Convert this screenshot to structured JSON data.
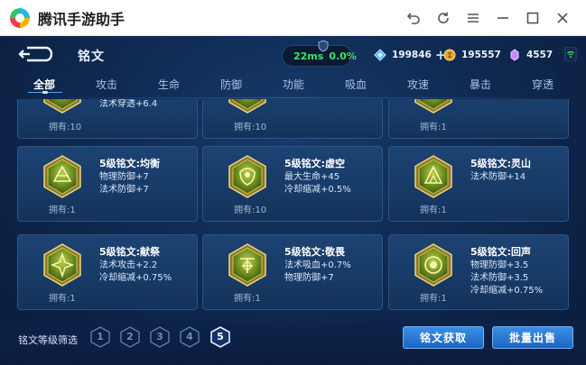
{
  "window": {
    "title": "腾讯手游助手",
    "controls": [
      "back-icon",
      "refresh-icon",
      "menu-icon",
      "minimize-icon",
      "maximize-icon",
      "close-icon"
    ]
  },
  "header": {
    "title": "铭文",
    "ping_ms": "22ms",
    "ping_loss": "0.0%",
    "currencies": [
      {
        "icon": "diamond-coupon-icon",
        "value": "199846",
        "has_plus": true
      },
      {
        "icon": "gold-coin-icon",
        "value": "195557",
        "has_plus": false
      },
      {
        "icon": "crystal-gem-icon",
        "value": "4557",
        "has_plus": false
      }
    ]
  },
  "tabs": [
    {
      "label": "全部",
      "active": true
    },
    {
      "label": "攻击",
      "active": false
    },
    {
      "label": "生命",
      "active": false
    },
    {
      "label": "防御",
      "active": false
    },
    {
      "label": "功能",
      "active": false
    },
    {
      "label": "吸血",
      "active": false
    },
    {
      "label": "攻速",
      "active": false
    },
    {
      "label": "暴击",
      "active": false
    },
    {
      "label": "穿透",
      "active": false
    }
  ],
  "cards": [
    {
      "name": "",
      "attrs": [
        "法术穿透+6.4"
      ],
      "own": "拥有:10",
      "color": "#6c8f22",
      "row": 0,
      "col": 0
    },
    {
      "name": "",
      "attrs": [],
      "own": "拥有:10",
      "color": "#6c8f22",
      "row": 0,
      "col": 1
    },
    {
      "name": "",
      "attrs": [],
      "own": "拥有:1",
      "color": "#6c8f22",
      "row": 0,
      "col": 2
    },
    {
      "name": "5级铭文:均衡",
      "attrs": [
        "物理防御+7",
        "法术防御+7"
      ],
      "own": "拥有:1",
      "color": "#7a9a1f",
      "row": 1,
      "col": 0
    },
    {
      "name": "5级铭文:虚空",
      "attrs": [
        "最大生命+45",
        "冷却缩减+0.5%"
      ],
      "own": "拥有:10",
      "color": "#7a9a1f",
      "row": 1,
      "col": 1
    },
    {
      "name": "5级铭文:灵山",
      "attrs": [
        "法术防御+14"
      ],
      "own": "拥有:1",
      "color": "#7a9a1f",
      "row": 1,
      "col": 2
    },
    {
      "name": "5级铭文:献祭",
      "attrs": [
        "法术攻击+2.2",
        "冷却缩减+0.75%"
      ],
      "own": "拥有:1",
      "color": "#7a9a1f",
      "row": 2,
      "col": 0
    },
    {
      "name": "5级铭文:敬畏",
      "attrs": [
        "法术吸血+0.7%",
        "物理防御+7"
      ],
      "own": "拥有:1",
      "color": "#7a9a1f",
      "row": 2,
      "col": 1
    },
    {
      "name": "5级铭文:回声",
      "attrs": [
        "物理防御+3.5",
        "法术防御+3.5",
        "冷却缩减+0.75%"
      ],
      "own": "拥有:1",
      "color": "#7a9a1f",
      "row": 2,
      "col": 2
    }
  ],
  "bottom": {
    "filter_label": "铭文等级筛选",
    "levels": [
      {
        "label": "1",
        "selected": false
      },
      {
        "label": "2",
        "selected": false
      },
      {
        "label": "3",
        "selected": false
      },
      {
        "label": "4",
        "selected": false
      },
      {
        "label": "5",
        "selected": true
      }
    ],
    "acquire_label": "铭文获取",
    "sell_label": "批量出售"
  },
  "colors": {
    "accent": "#3a8fe6",
    "ping_green": "#3ee36b",
    "card_bg": "#1d4373",
    "emblem_gold": "#c9b04a"
  }
}
